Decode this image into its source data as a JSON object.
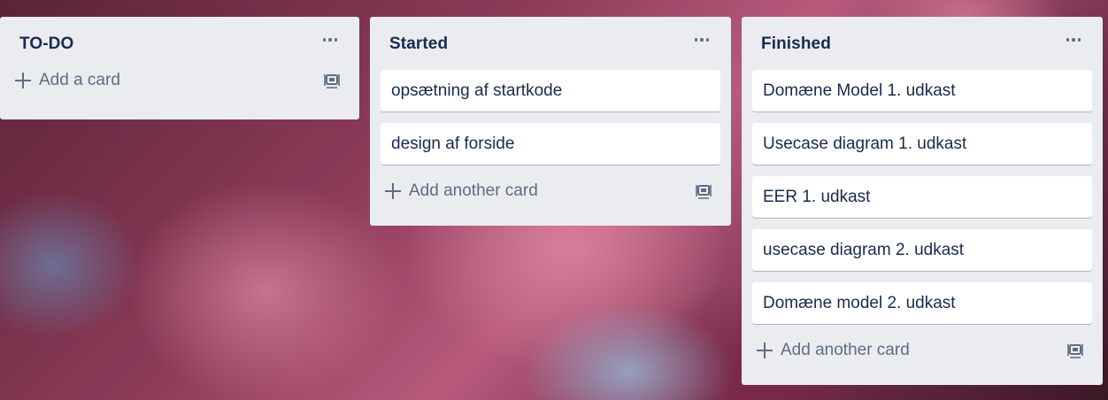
{
  "lists": [
    {
      "title": "TO-DO",
      "cards": [],
      "add_label": "Add a card"
    },
    {
      "title": "Started",
      "cards": [
        "opsætning af startkode",
        "design af forside"
      ],
      "add_label": "Add another card"
    },
    {
      "title": "Finished",
      "cards": [
        "Domæne Model 1. udkast",
        "Usecase diagram 1. udkast",
        "EER 1. udkast",
        "usecase diagram 2. udkast",
        "Domæne model 2. udkast"
      ],
      "add_label": "Add another card"
    }
  ],
  "icons": {
    "menu": "more-horizontal-icon",
    "add": "plus-icon",
    "template": "card-template-icon"
  },
  "colors": {
    "list_background": "#ebecf0",
    "card_background": "#ffffff",
    "title_text": "#172b4d",
    "muted_text": "#5e6c84"
  }
}
